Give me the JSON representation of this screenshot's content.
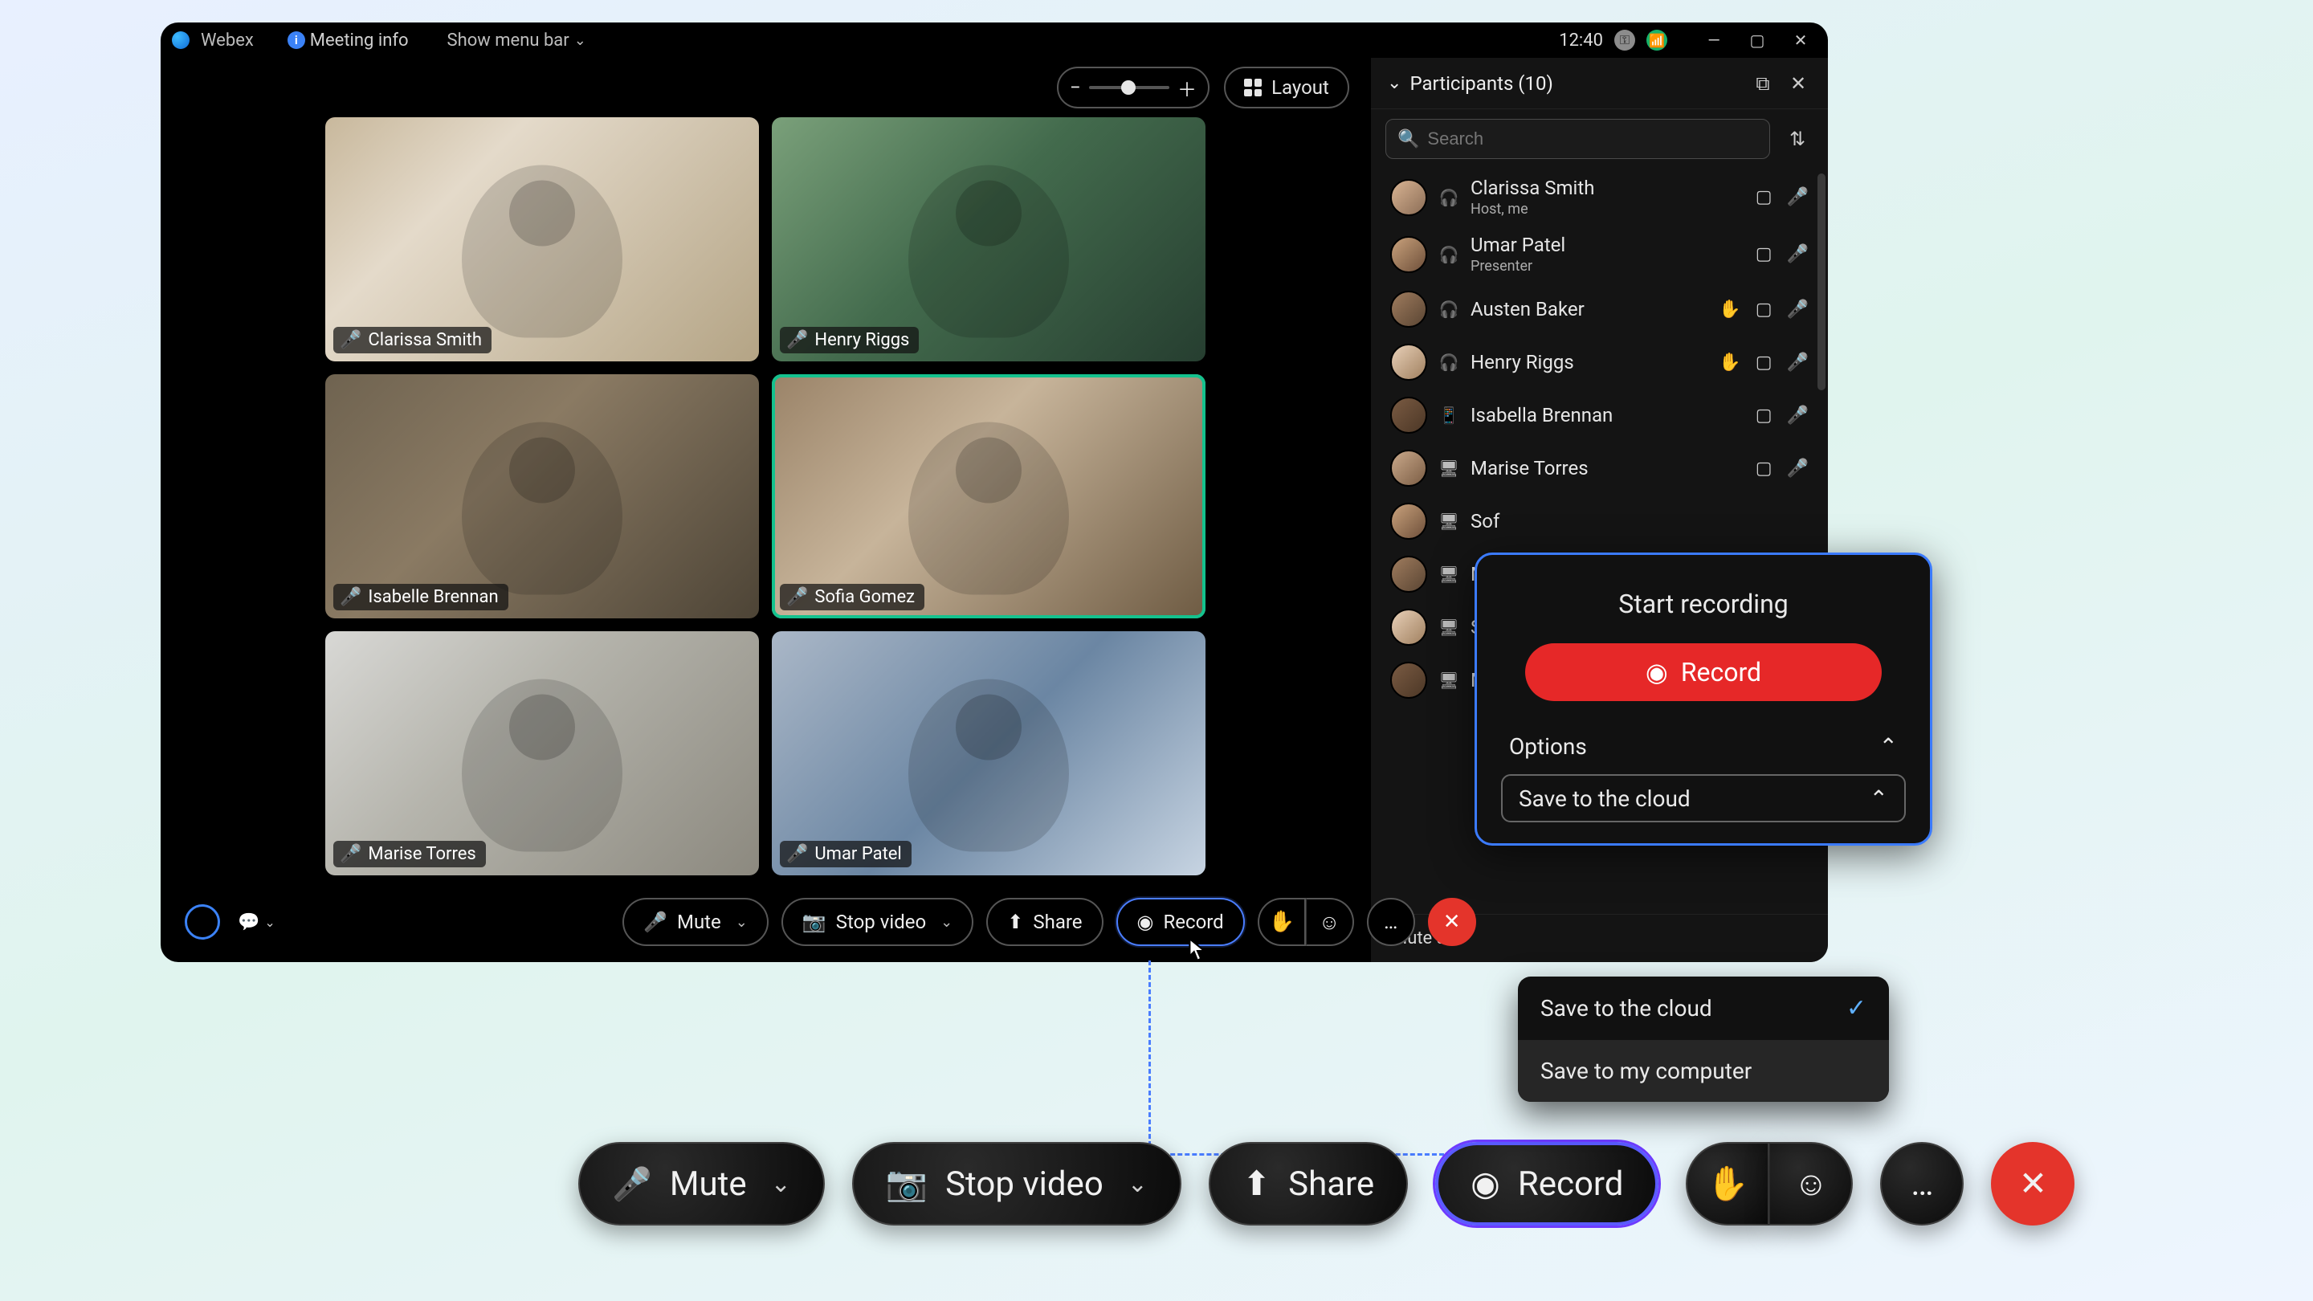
{
  "titlebar": {
    "app_name": "Webex",
    "meeting_info_label": "Meeting info",
    "show_menu_label": "Show menu bar",
    "clock": "12:40"
  },
  "grid_toolbar": {
    "layout_label": "Layout"
  },
  "tiles": [
    {
      "name": "Clarissa Smith",
      "mic": "on"
    },
    {
      "name": "Henry Riggs",
      "mic": "on"
    },
    {
      "name": "Isabelle Brennan",
      "mic": "off"
    },
    {
      "name": "Sofia Gomez",
      "mic": "on",
      "active": true
    },
    {
      "name": "Marise Torres",
      "mic": "off"
    },
    {
      "name": "Umar Patel",
      "mic": "on"
    }
  ],
  "participants": {
    "title": "Participants (10)",
    "search_placeholder": "Search",
    "mute_all_label": "Mute all",
    "list": [
      {
        "name": "Clarissa Smith",
        "role": "Host, me",
        "mic": "on",
        "cam": true
      },
      {
        "name": "Umar Patel",
        "role": "Presenter",
        "mic": "on",
        "cam": true
      },
      {
        "name": "Austen Baker",
        "role": "",
        "mic": "off",
        "cam": true,
        "hand": true
      },
      {
        "name": "Henry Riggs",
        "role": "",
        "mic": "off",
        "cam": true,
        "hand": true
      },
      {
        "name": "Isabella Brennan",
        "role": "",
        "mic": "off",
        "cam": true
      },
      {
        "name": "Marise Torres",
        "role": "",
        "mic": "off",
        "cam": true
      },
      {
        "name": "Sof",
        "role": "",
        "mic": "",
        "cam": false
      },
      {
        "name": "Mu",
        "role": "",
        "mic": "",
        "cam": false
      },
      {
        "name": "So",
        "role": "",
        "mic": "",
        "cam": false
      },
      {
        "name": "Ma",
        "role": "",
        "mic": "",
        "cam": false
      }
    ]
  },
  "appbar": {
    "mute": "Mute",
    "stop_video": "Stop video",
    "share": "Share",
    "record": "Record"
  },
  "rec_popup": {
    "title": "Start recording",
    "record_btn": "Record",
    "options_label": "Options",
    "selected_option": "Save to the cloud",
    "dropdown": [
      "Save to the cloud",
      "Save to my computer"
    ]
  },
  "zoombar": {
    "mute": "Mute",
    "stop_video": "Stop video",
    "share": "Share",
    "record": "Record"
  }
}
